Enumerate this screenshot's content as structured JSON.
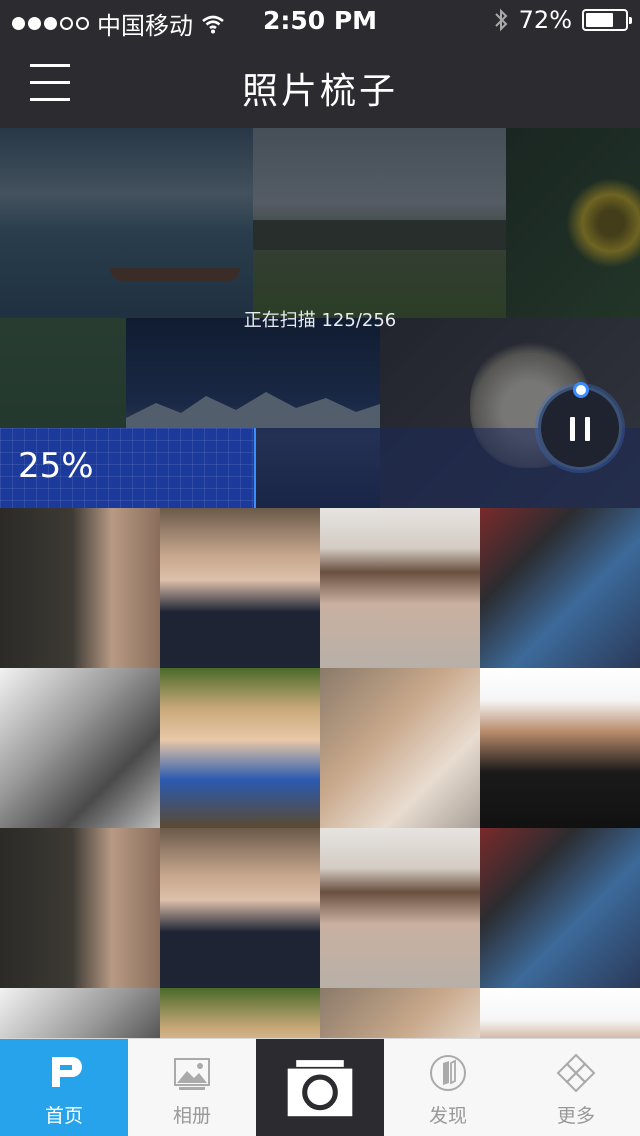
{
  "status_bar": {
    "carrier": "中国移动",
    "time": "2:50 PM",
    "battery_text": "72%",
    "battery_level": 0.72,
    "signal_bars_filled": 3,
    "signal_bars_total": 5,
    "icons": [
      "signal-dots-icon",
      "wifi-icon",
      "bluetooth-icon",
      "battery-icon"
    ]
  },
  "nav": {
    "title": "照片梳子",
    "menu_icon": "hamburger-menu-icon"
  },
  "scan": {
    "status_text": "正在扫描 125/256",
    "scanned": 125,
    "total": 256,
    "progress_text": "25%",
    "progress_fraction": 0.25,
    "pause_icon": "pause-icon",
    "accent_color": "#3a8cff"
  },
  "photo_grid": {
    "rows_visible": 4,
    "columns": 4
  },
  "tab_bar": {
    "active_color": "#27a3ec",
    "tabs": [
      {
        "label": "首页",
        "icon": "home-p-icon",
        "active": true
      },
      {
        "label": "相册",
        "icon": "album-icon",
        "active": false
      },
      {
        "label": "",
        "icon": "camera-icon",
        "active": false
      },
      {
        "label": "发现",
        "icon": "discover-icon",
        "active": false
      },
      {
        "label": "更多",
        "icon": "more-icon",
        "active": false
      }
    ]
  }
}
